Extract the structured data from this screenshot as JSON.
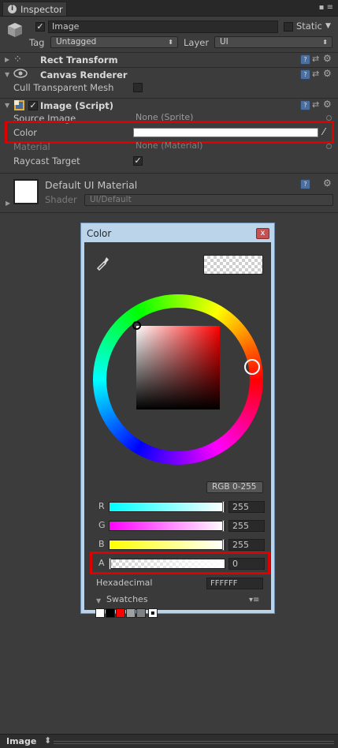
{
  "tab": {
    "title": "Inspector"
  },
  "object": {
    "name": "Image",
    "static_label": "Static",
    "tag_label": "Tag",
    "tag_value": "Untagged",
    "layer_label": "Layer",
    "layer_value": "UI"
  },
  "components": {
    "rect_transform": "Rect Transform",
    "canvas_renderer": "Canvas Renderer",
    "cull_label": "Cull Transparent Mesh",
    "image_script": "Image (Script)",
    "source_image_label": "Source Image",
    "source_image_value": "None (Sprite)",
    "color_label": "Color",
    "material_label": "Material",
    "material_value": "None (Material)",
    "raycast_label": "Raycast Target"
  },
  "material_section": {
    "name": "Default UI Material",
    "shader_label": "Shader",
    "shader_value": "UI/Default"
  },
  "picker": {
    "title": "Color",
    "close": "x",
    "mode": "RGB 0-255",
    "channels": [
      {
        "label": "R",
        "value": "255"
      },
      {
        "label": "G",
        "value": "255"
      },
      {
        "label": "B",
        "value": "255"
      },
      {
        "label": "A",
        "value": "0"
      }
    ],
    "hex_label": "Hexadecimal",
    "hex_value": "FFFFFF",
    "swatches_label": "Swatches",
    "swatch_colors": [
      "#ffffff",
      "#000000",
      "#ff0000",
      "#a0a0a0",
      "#808080"
    ]
  },
  "status": {
    "label": "Image"
  }
}
